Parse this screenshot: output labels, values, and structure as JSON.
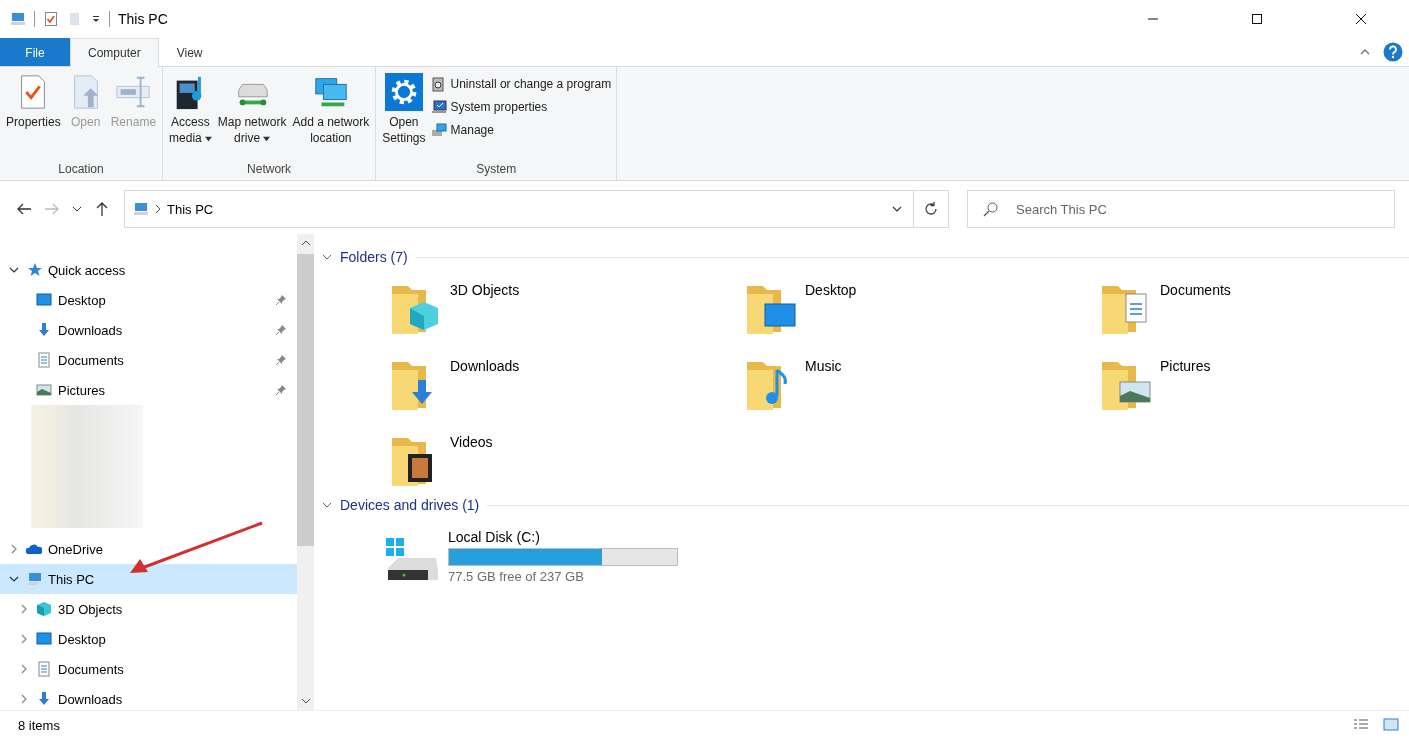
{
  "window": {
    "title": "This PC"
  },
  "ribbon_tabs": [
    {
      "label": "File",
      "kind": "file",
      "selected": false
    },
    {
      "label": "Computer",
      "kind": "tab",
      "selected": true
    },
    {
      "label": "View",
      "kind": "tab",
      "selected": false
    }
  ],
  "ribbon_groups": [
    {
      "label": "Location",
      "buttons": [
        {
          "kind": "properties",
          "lines": [
            "Properties"
          ],
          "dropdown": false,
          "disabled": false
        },
        {
          "kind": "open",
          "lines": [
            "Open"
          ],
          "dropdown": false,
          "disabled": true
        },
        {
          "kind": "rename",
          "lines": [
            "Rename"
          ],
          "dropdown": false,
          "disabled": true
        }
      ]
    },
    {
      "label": "Network",
      "buttons": [
        {
          "kind": "media",
          "lines": [
            "Access",
            "media"
          ],
          "dropdown": true,
          "disabled": false
        },
        {
          "kind": "drive",
          "lines": [
            "Map network",
            "drive"
          ],
          "dropdown": true,
          "disabled": false
        },
        {
          "kind": "netloc",
          "lines": [
            "Add a network",
            "location"
          ],
          "dropdown": false,
          "disabled": false
        }
      ]
    },
    {
      "label": "System",
      "buttons": [
        {
          "kind": "settings",
          "lines": [
            "Open",
            "Settings"
          ],
          "dropdown": false,
          "disabled": false
        }
      ],
      "small_buttons": [
        {
          "kind": "uninstall",
          "label": "Uninstall or change a program"
        },
        {
          "kind": "sysprops",
          "label": "System properties"
        },
        {
          "kind": "manage",
          "label": "Manage"
        }
      ]
    }
  ],
  "address": {
    "path": "This PC",
    "search_placeholder": "Search This PC"
  },
  "navigation": [
    {
      "kind": "star",
      "label": "Quick access",
      "expanded": true,
      "selected": false,
      "children": [
        {
          "kind": "desktop",
          "label": "Desktop",
          "pinned": true,
          "selected": false
        },
        {
          "kind": "downloads",
          "label": "Downloads",
          "pinned": true,
          "selected": false
        },
        {
          "kind": "documents",
          "label": "Documents",
          "pinned": true,
          "selected": false
        },
        {
          "kind": "pictures",
          "label": "Pictures",
          "pinned": true,
          "selected": false
        },
        {
          "kind": "blurred"
        }
      ]
    },
    {
      "kind": "cloud",
      "label": "OneDrive",
      "expanded": false,
      "selected": false
    },
    {
      "kind": "pc",
      "label": "This PC",
      "expanded": true,
      "selected": true,
      "children": [
        {
          "kind": "cube",
          "label": "3D Objects",
          "expanded": false,
          "selected": false
        },
        {
          "kind": "desktop",
          "label": "Desktop",
          "expanded": false,
          "selected": false
        },
        {
          "kind": "documents",
          "label": "Documents",
          "expanded": false,
          "selected": false
        },
        {
          "kind": "downloads",
          "label": "Downloads",
          "expanded": false,
          "selected": false
        }
      ]
    }
  ],
  "sections": [
    {
      "kind": "folders",
      "title": "Folders (7)",
      "expanded": true,
      "items": [
        {
          "kind": "cube",
          "label": "3D Objects"
        },
        {
          "kind": "desktop",
          "label": "Desktop"
        },
        {
          "kind": "documents",
          "label": "Documents"
        },
        {
          "kind": "downloads",
          "label": "Downloads"
        },
        {
          "kind": "music",
          "label": "Music"
        },
        {
          "kind": "pictures",
          "label": "Pictures"
        },
        {
          "kind": "videos",
          "label": "Videos"
        }
      ]
    },
    {
      "kind": "drives",
      "title": "Devices and drives (1)",
      "expanded": true,
      "items": [
        {
          "label": "Local Disk (C:)",
          "level": 0.67,
          "free": "77.5 GB free of 237 GB"
        }
      ]
    }
  ],
  "status_bar": {
    "count": "8 items"
  }
}
